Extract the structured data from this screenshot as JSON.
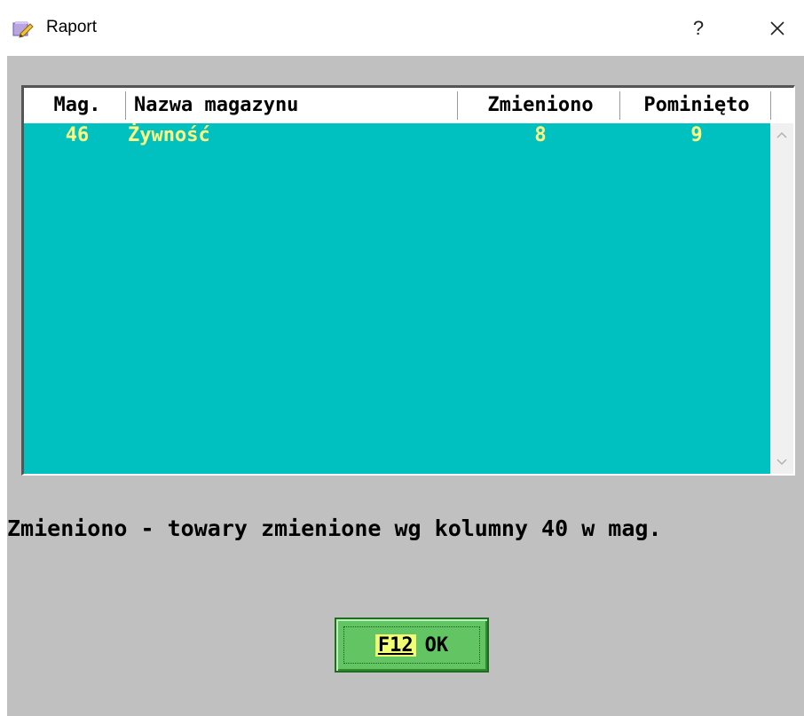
{
  "window": {
    "title": "Raport",
    "help_label": "?"
  },
  "grid": {
    "columns": [
      "Mag.",
      "Nazwa magazynu",
      "Zmieniono",
      "Pominięto"
    ],
    "rows": [
      {
        "mag": "46",
        "name": "Żywność",
        "changed": "8",
        "skipped": "9"
      }
    ]
  },
  "info": {
    "text": "Zmieniono - towary zmienione wg kolumny 40 w mag."
  },
  "ok_button": {
    "key": "F12",
    "label": "OK"
  },
  "colors": {
    "grid_background": "#00c0c0",
    "row_text": "#ffff80",
    "dialog_background": "#c0c0c0",
    "ok_button": "#62c462",
    "key_highlight": "#f2ff73"
  }
}
